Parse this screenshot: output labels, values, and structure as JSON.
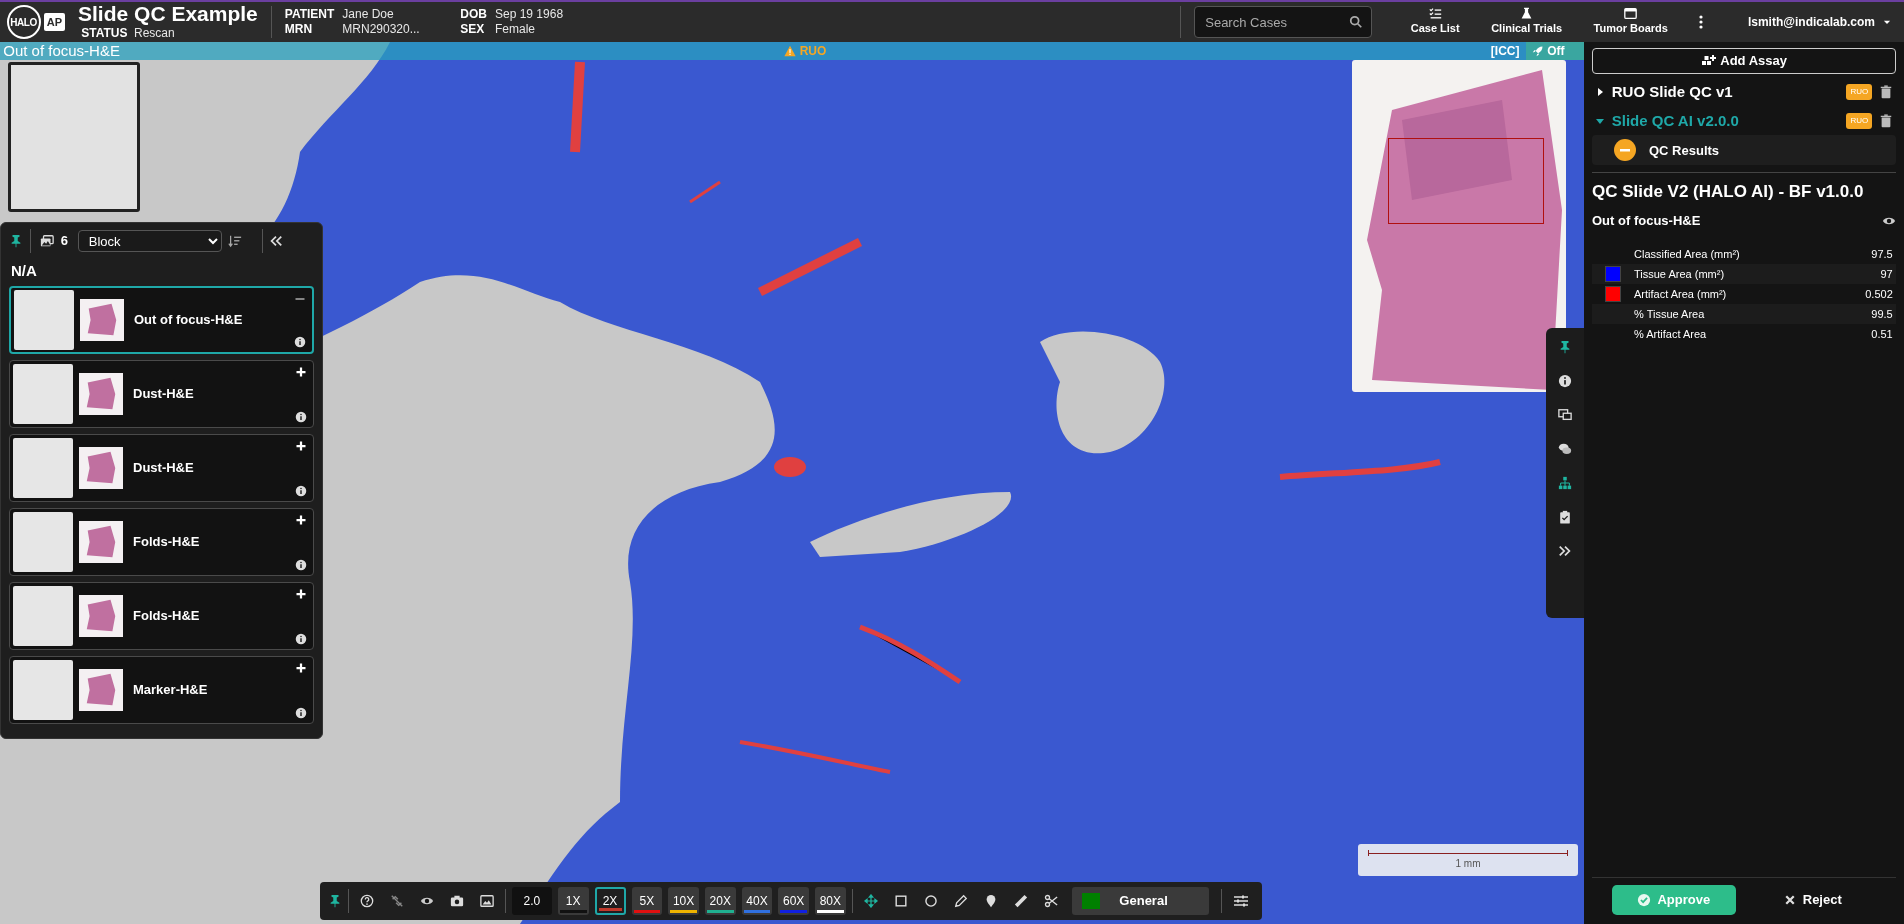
{
  "header": {
    "logo": {
      "left": "HALO",
      "right": "AP"
    },
    "title": "Slide QC Example",
    "status_label": "STATUS",
    "status": "Rescan",
    "patient_fields": [
      {
        "label": "PATIENT",
        "value": "Jane Doe"
      },
      {
        "label": "MRN",
        "value": "MRN290320..."
      },
      {
        "label": "DOB",
        "value": "Sep 19 1968"
      },
      {
        "label": "SEX",
        "value": "Female"
      }
    ],
    "search": {
      "placeholder": "Search Cases"
    },
    "nav": [
      {
        "label": "Case List",
        "kind": "list"
      },
      {
        "label": "Clinical Trials",
        "kind": "flask"
      },
      {
        "label": "Tumor Boards",
        "kind": "window"
      }
    ],
    "user": "lsmith@indicalab.com"
  },
  "viewer": {
    "image_name": "Out of focus-H&E",
    "ruo": "RUO",
    "icc": "[ICC]",
    "toggle": "Off",
    "scale": "1 mm"
  },
  "slide_list": {
    "count": "6",
    "group_by": "Block",
    "group": "N/A",
    "slides": [
      {
        "name": "Out of focus-H&E",
        "selected": true
      },
      {
        "name": "Dust-H&E",
        "selected": false
      },
      {
        "name": "Dust-H&E",
        "selected": false
      },
      {
        "name": "Folds-H&E",
        "selected": false
      },
      {
        "name": "Folds-H&E",
        "selected": false
      },
      {
        "name": "Marker-H&E",
        "selected": false
      }
    ]
  },
  "toolbar": {
    "zoom": "2.0",
    "magnifications": [
      {
        "label": "1X",
        "selected": false,
        "color": "#111111"
      },
      {
        "label": "2X",
        "selected": true,
        "color": "#c0392b"
      },
      {
        "label": "5X",
        "selected": false,
        "color": "#e01010"
      },
      {
        "label": "10X",
        "selected": false,
        "color": "#f0b400"
      },
      {
        "label": "20X",
        "selected": false,
        "color": "#20b090"
      },
      {
        "label": "40X",
        "selected": false,
        "color": "#3070e0"
      },
      {
        "label": "60X",
        "selected": false,
        "color": "#1020e0"
      },
      {
        "label": "80X",
        "selected": false,
        "color": "#ffffff"
      }
    ],
    "class_select": {
      "label": "General",
      "color": "#008000"
    }
  },
  "right_panel": {
    "add_assay": "Add Assay",
    "assays": [
      {
        "name": "RUO Slide QC v1",
        "badge": "RUO",
        "expanded": false
      },
      {
        "name": "Slide QC AI v2.0.0",
        "badge": "RUO",
        "expanded": true
      }
    ],
    "qc_results": "QC Results",
    "result_title": "QC Slide V2 (HALO AI) - BF v1.0.0",
    "result_subtitle": "Out of focus-H&E",
    "rows": [
      {
        "label": "Classified Area (mm²)",
        "value": "97.5"
      },
      {
        "label": "Tissue Area (mm²)",
        "value": "97",
        "color": "#0000ff"
      },
      {
        "label": "Artifact Area (mm²)",
        "value": "0.502",
        "color": "#ff0000"
      },
      {
        "label": "% Tissue Area",
        "value": "99.5"
      },
      {
        "label": "% Artifact Area",
        "value": "0.51"
      }
    ],
    "approve": "Approve",
    "reject": "Reject"
  }
}
